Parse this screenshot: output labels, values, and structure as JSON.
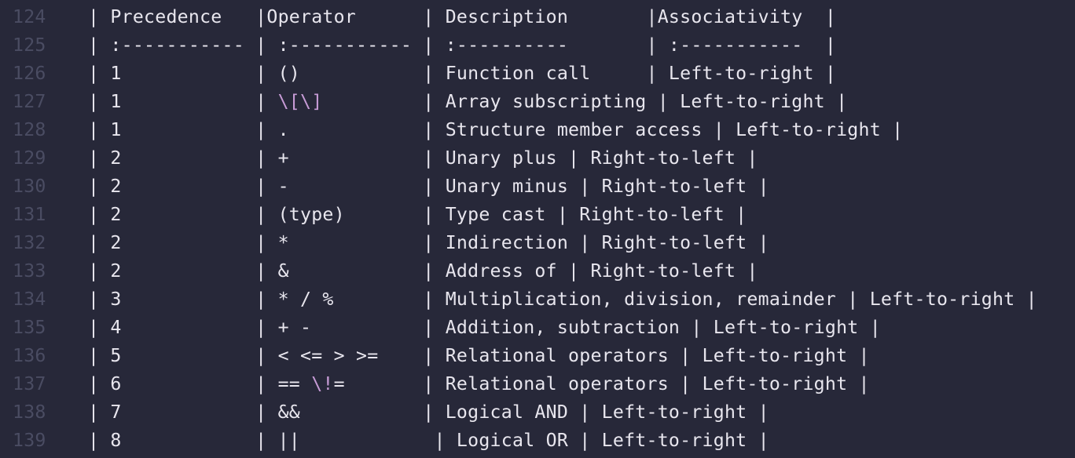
{
  "editor": {
    "accent_colors": {
      "background": "#272839",
      "line_number": "#4a4c62",
      "text": "#e8e6ee",
      "escape": "#c79bd6"
    },
    "lines": [
      {
        "num": "124",
        "segments": [
          {
            "text": "| Precedence   |Operator      | Description       |Associativity  |",
            "esc": false
          }
        ]
      },
      {
        "num": "125",
        "segments": [
          {
            "text": "| :----------- | :----------- | :----------       | :-----------  |",
            "esc": false
          }
        ]
      },
      {
        "num": "126",
        "segments": [
          {
            "text": "| 1            | ()           | Function call     | Left-to-right |",
            "esc": false
          }
        ]
      },
      {
        "num": "127",
        "segments": [
          {
            "text": "| 1            | ",
            "esc": false
          },
          {
            "text": "\\[\\]",
            "esc": true
          },
          {
            "text": "         | Array subscripting | Left-to-right |",
            "esc": false
          }
        ]
      },
      {
        "num": "128",
        "segments": [
          {
            "text": "| 1            | .            | Structure member access | Left-to-right |",
            "esc": false
          }
        ]
      },
      {
        "num": "129",
        "segments": [
          {
            "text": "| 2            | +            | Unary plus | Right-to-left |",
            "esc": false
          }
        ]
      },
      {
        "num": "130",
        "segments": [
          {
            "text": "| 2            | -            | Unary minus | Right-to-left |",
            "esc": false
          }
        ]
      },
      {
        "num": "131",
        "segments": [
          {
            "text": "| 2            | (type)       | Type cast | Right-to-left |",
            "esc": false
          }
        ]
      },
      {
        "num": "132",
        "segments": [
          {
            "text": "| 2            | *            | Indirection | Right-to-left |",
            "esc": false
          }
        ]
      },
      {
        "num": "133",
        "segments": [
          {
            "text": "| 2            | &            | Address of | Right-to-left |",
            "esc": false
          }
        ]
      },
      {
        "num": "134",
        "segments": [
          {
            "text": "| 3            | * / %        | Multiplication, division, remainder | Left-to-right |",
            "esc": false
          }
        ]
      },
      {
        "num": "135",
        "segments": [
          {
            "text": "| 4            | + -          | Addition, subtraction | Left-to-right |",
            "esc": false
          }
        ]
      },
      {
        "num": "136",
        "segments": [
          {
            "text": "| 5            | < <= > >=    | Relational operators | Left-to-right |",
            "esc": false
          }
        ]
      },
      {
        "num": "137",
        "segments": [
          {
            "text": "| 6            | == ",
            "esc": false
          },
          {
            "text": "\\!",
            "esc": true
          },
          {
            "text": "=       | Relational operators | Left-to-right |",
            "esc": false
          }
        ]
      },
      {
        "num": "138",
        "segments": [
          {
            "text": "| 7            | &&           | Logical AND | Left-to-right |",
            "esc": false
          }
        ]
      },
      {
        "num": "139",
        "segments": [
          {
            "text": "| 8            | ||            | Logical OR | Left-to-right |",
            "esc": false
          }
        ]
      }
    ]
  }
}
